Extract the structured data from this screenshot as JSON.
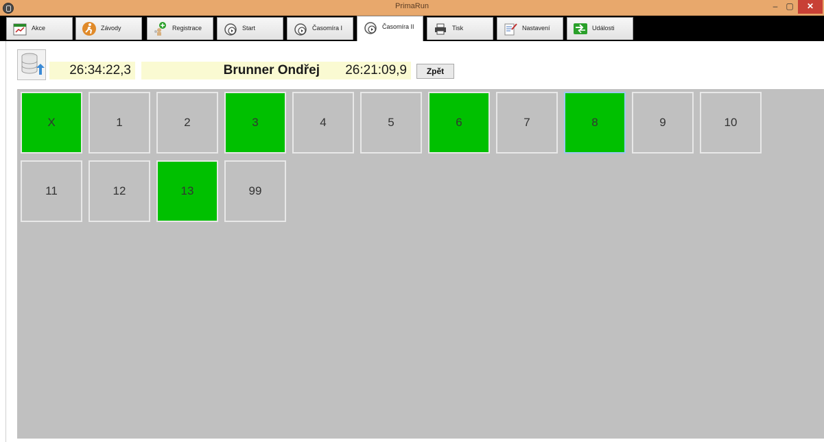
{
  "window": {
    "title": "PrimaRun"
  },
  "tabs": [
    {
      "label": "Akce",
      "icon": "calendar-icon"
    },
    {
      "label": "Závody",
      "icon": "runner-icon"
    },
    {
      "label": "Registrace",
      "icon": "add-user-icon"
    },
    {
      "label": "Start",
      "icon": "stopwatch-icon"
    },
    {
      "label": "Časomíra I",
      "icon": "stopwatch-icon"
    },
    {
      "label": "Časomíra II",
      "icon": "stopwatch-icon",
      "active": true
    },
    {
      "label": "Tisk",
      "icon": "printer-icon"
    },
    {
      "label": "Nastavení",
      "icon": "settings-icon"
    },
    {
      "label": "Události",
      "icon": "events-icon"
    }
  ],
  "header": {
    "time_total": "26:34:22,3",
    "runner_name": "Brunner Ondřej",
    "runner_time": "26:21:09,9",
    "back_label": "Zpět"
  },
  "tiles": [
    {
      "label": "X",
      "green": true
    },
    {
      "label": "1",
      "green": false
    },
    {
      "label": "2",
      "green": false
    },
    {
      "label": "3",
      "green": true
    },
    {
      "label": "4",
      "green": false
    },
    {
      "label": "5",
      "green": false
    },
    {
      "label": "6",
      "green": true
    },
    {
      "label": "7",
      "green": false
    },
    {
      "label": "8",
      "green": true,
      "selected": true
    },
    {
      "label": "9",
      "green": false
    },
    {
      "label": "10",
      "green": false
    },
    {
      "label": "11",
      "green": false
    },
    {
      "label": "12",
      "green": false
    },
    {
      "label": "13",
      "green": true
    },
    {
      "label": "99",
      "green": false
    }
  ],
  "colors": {
    "tile_green": "#00c000",
    "panel": "#c0c0c0",
    "titlebar": "#e8a86c"
  }
}
